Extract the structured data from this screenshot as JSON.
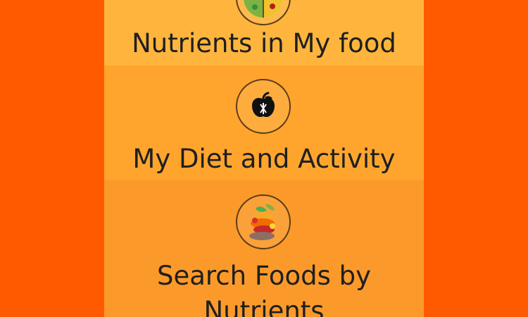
{
  "menu": {
    "items": [
      {
        "label": "Nutrients in My food",
        "icon": "food-plate-icon"
      },
      {
        "label": "My Diet and Activity",
        "icon": "apple-icon"
      },
      {
        "label": "Search Foods by Nutrients",
        "icon": "food-stack-icon"
      }
    ]
  },
  "colors": {
    "background": "#FF5A00",
    "item_1": "#FFB53D",
    "item_2": "#FFA52E",
    "item_3": "#FB9A2A",
    "text": "#1F1F1F"
  }
}
